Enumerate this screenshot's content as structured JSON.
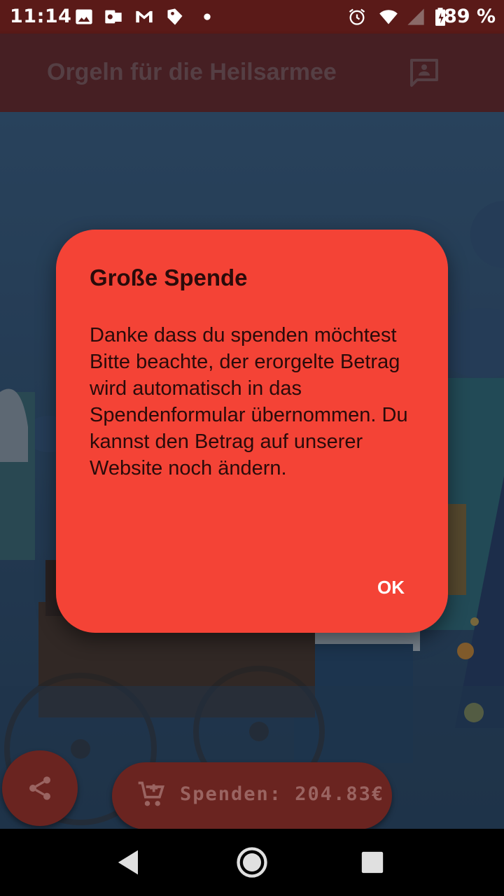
{
  "status_bar": {
    "time": "11:14",
    "battery": "89 %",
    "icons": [
      "image-icon",
      "outlook-icon",
      "gmail-icon",
      "tag-icon",
      "dot-icon",
      "alarm-icon",
      "wifi-icon",
      "signal-icon",
      "battery-icon"
    ]
  },
  "app_bar": {
    "title": "Orgeln für die Heilsarmee",
    "action_icon": "contact-card-icon"
  },
  "dialog": {
    "title": "Große Spende",
    "body": "Danke dass du spenden möchtest\nBitte beachte, der erorgelte Betrag wird automatisch in das Spendenformular übernommen. Du kannst den Betrag auf unserer Website noch ändern.",
    "ok_label": "OK",
    "background_color": "#f44336"
  },
  "bottom": {
    "share_icon": "share-icon",
    "donate_label": "Spenden: 204.83€",
    "donate_icon": "add-cart-icon"
  },
  "nav_bar": {
    "icons": [
      "back-icon",
      "home-icon",
      "recents-icon"
    ]
  }
}
